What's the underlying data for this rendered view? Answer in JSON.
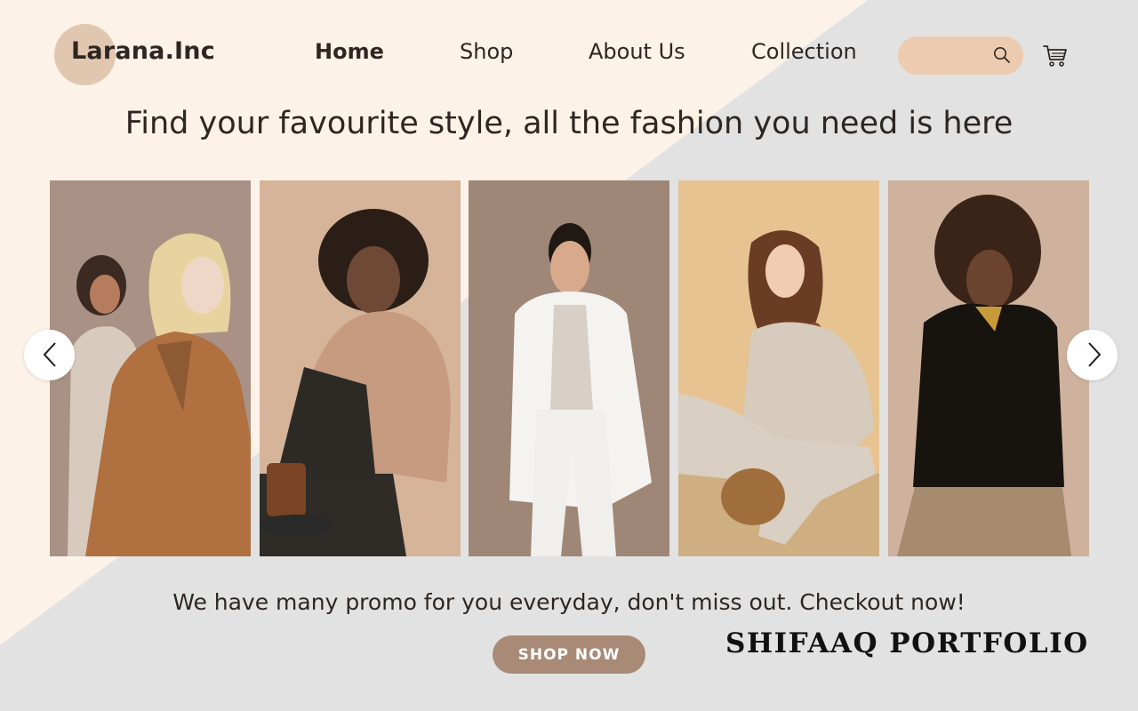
{
  "brand": {
    "name": "Larana.Inc"
  },
  "nav": {
    "items": [
      {
        "label": "Home",
        "active": true
      },
      {
        "label": "Shop",
        "active": false
      },
      {
        "label": "About Us",
        "active": false
      },
      {
        "label": "Collection",
        "active": false
      }
    ]
  },
  "search": {
    "placeholder": "",
    "value": "",
    "icon": "search-icon"
  },
  "cart": {
    "icon": "cart-icon"
  },
  "hero": {
    "headline": "Find your favourite style, all the fashion you need is here"
  },
  "carousel": {
    "prev_icon": "chevron-left-icon",
    "next_icon": "chevron-right-icon",
    "photos": [
      {
        "name": "model-photo-1"
      },
      {
        "name": "model-photo-2"
      },
      {
        "name": "model-photo-3"
      },
      {
        "name": "model-photo-4"
      },
      {
        "name": "model-photo-5"
      }
    ]
  },
  "promo": {
    "text": "We have many promo for you everyday, don't miss out. Checkout now!",
    "button_label": "SHOP NOW"
  },
  "watermark": {
    "text": "SHIFAAQ PORTFOLIO"
  },
  "colors": {
    "cream": "#fcf2e7",
    "grey": "#e2e2e2",
    "accent_tan": "#e2c7b0",
    "search_bg": "#eccbb1",
    "button_bg": "#a88a76",
    "text": "#2e2622"
  }
}
